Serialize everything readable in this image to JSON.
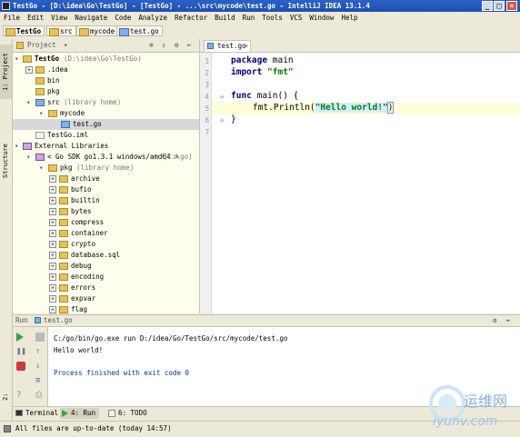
{
  "window": {
    "title": "TestGo - [D:\\idea\\Go\\TestGo] - [TestGo] - ...\\src\\mycode\\test.go - IntelliJ IDEA 13.1.4"
  },
  "menu": [
    "File",
    "Edit",
    "View",
    "Navigate",
    "Code",
    "Analyze",
    "Refactor",
    "Build",
    "Run",
    "Tools",
    "VCS",
    "Window",
    "Help"
  ],
  "breadcrumbs": [
    "TestGo",
    "src",
    "mycode",
    "test.go"
  ],
  "left_strip": {
    "project_tab": "1: Project",
    "structure_tab": "Structure",
    "favorites_tab": "2: Favorites"
  },
  "project_panel": {
    "dropdown": "Project",
    "tree": [
      {
        "label": "TestGo",
        "extra": "(D:\\idea\\Go\\TestGo)"
      },
      {
        "label": ".idea",
        "extra": ""
      },
      {
        "label": "bin",
        "extra": ""
      },
      {
        "label": "pkg",
        "extra": ""
      },
      {
        "label": "src",
        "extra": "(library home)"
      },
      {
        "label": "mycode",
        "extra": ""
      },
      {
        "label": "test.go",
        "extra": ""
      },
      {
        "label": "TestGo.iml",
        "extra": ""
      },
      {
        "label": "External Libraries",
        "extra": ""
      },
      {
        "label": "< Go SDK go1.3.1 windows/amd64 >",
        "extra": "(C:\\go)"
      },
      {
        "label": "pkg",
        "extra": "(library home)"
      },
      {
        "label": "archive",
        "extra": ""
      },
      {
        "label": "bufio",
        "extra": ""
      },
      {
        "label": "builtin",
        "extra": ""
      },
      {
        "label": "bytes",
        "extra": ""
      },
      {
        "label": "compress",
        "extra": ""
      },
      {
        "label": "container",
        "extra": ""
      },
      {
        "label": "crypto",
        "extra": ""
      },
      {
        "label": "database.sql",
        "extra": ""
      },
      {
        "label": "debug",
        "extra": ""
      },
      {
        "label": "encoding",
        "extra": ""
      },
      {
        "label": "errors",
        "extra": ""
      },
      {
        "label": "expvar",
        "extra": ""
      },
      {
        "label": "flag",
        "extra": ""
      }
    ]
  },
  "editor": {
    "tab": "test.go",
    "line_numbers": [
      "1",
      "2",
      "3",
      "4",
      "5",
      "6",
      "7"
    ],
    "code": {
      "l1_kw": "package",
      "l1_rest": " main",
      "l2_kw": "import",
      "l2_str": " \"fmt\"",
      "l4_kw": "func",
      "l4_rest": " main() {",
      "l5_pre": "fmt.Println(",
      "l5_str": "\"Hello world!\"",
      "l5_post": ")",
      "l6": "}"
    }
  },
  "run_panel": {
    "header_label": "Run",
    "header_tab": "test.go",
    "command": "C:/go/bin/go.exe run D:/idea/Go/TestGo/src/mycode/test.go",
    "output": "Hello world!",
    "finished": "Process finished with exit code 0"
  },
  "bottom_tabs": [
    "Terminal",
    "4: Run",
    "6: TODO"
  ],
  "status": "All files are up-to-date (today 14:57)",
  "watermark": {
    "brand": "运维网",
    "url": "iyunv.com"
  },
  "colors": {
    "keyword": "#000080",
    "string": "#008000",
    "title_bar": "#2a62c9"
  }
}
